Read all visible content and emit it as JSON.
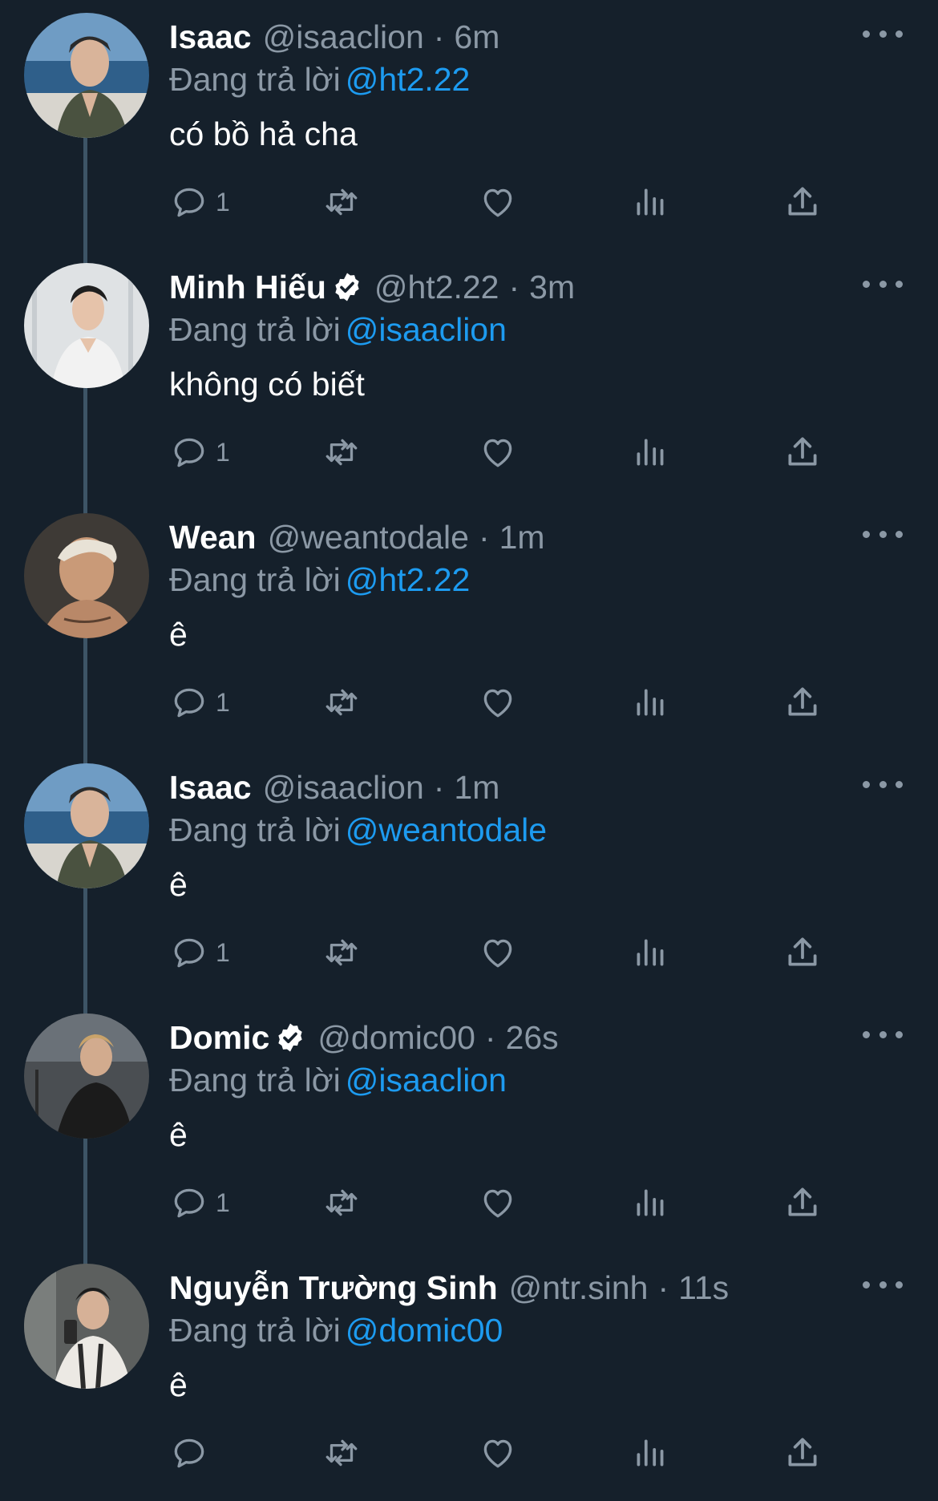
{
  "colors": {
    "background": "#15202b",
    "text_primary": "#ffffff",
    "text_secondary": "#8b98a5",
    "accent": "#1d9bf0",
    "thread_line": "#3d5466"
  },
  "replying_prefix": "Đang trả lời",
  "tweets": [
    {
      "name": "Isaac",
      "verified": false,
      "handle": "@isaaclion",
      "separator": "·",
      "time": "6m",
      "replying_to": "@ht2.22",
      "text": "có bồ hả cha",
      "reply_count": "1",
      "avatar_icon": "avatar-isaac"
    },
    {
      "name": "Minh Hiếu",
      "verified": true,
      "handle": "@ht2.22",
      "separator": "·",
      "time": "3m",
      "replying_to": "@isaaclion",
      "text": "không có biết",
      "reply_count": "1",
      "avatar_icon": "avatar-minh-hieu"
    },
    {
      "name": "Wean",
      "verified": false,
      "handle": "@weantodale",
      "separator": "·",
      "time": "1m",
      "replying_to": "@ht2.22",
      "text": "ê",
      "reply_count": "1",
      "avatar_icon": "avatar-wean"
    },
    {
      "name": "Isaac",
      "verified": false,
      "handle": "@isaaclion",
      "separator": "·",
      "time": "1m",
      "replying_to": "@weantodale",
      "text": "ê",
      "reply_count": "1",
      "avatar_icon": "avatar-isaac"
    },
    {
      "name": "Domic",
      "verified": true,
      "handle": "@domic00",
      "separator": "·",
      "time": "26s",
      "replying_to": "@isaaclion",
      "text": "ê",
      "reply_count": "1",
      "avatar_icon": "avatar-domic"
    },
    {
      "name": "Nguyễn Trường Sinh",
      "verified": false,
      "handle": "@ntr.sinh",
      "separator": "·",
      "time": "11s",
      "replying_to": "@domic00",
      "text": "ê",
      "reply_count": "",
      "avatar_icon": "avatar-ntr-sinh"
    }
  ],
  "icons": {
    "reply": "reply-icon",
    "retweet": "retweet-icon",
    "like": "heart-icon",
    "views": "views-icon",
    "share": "share-icon",
    "more": "more-icon",
    "verified": "verified-badge-icon"
  }
}
